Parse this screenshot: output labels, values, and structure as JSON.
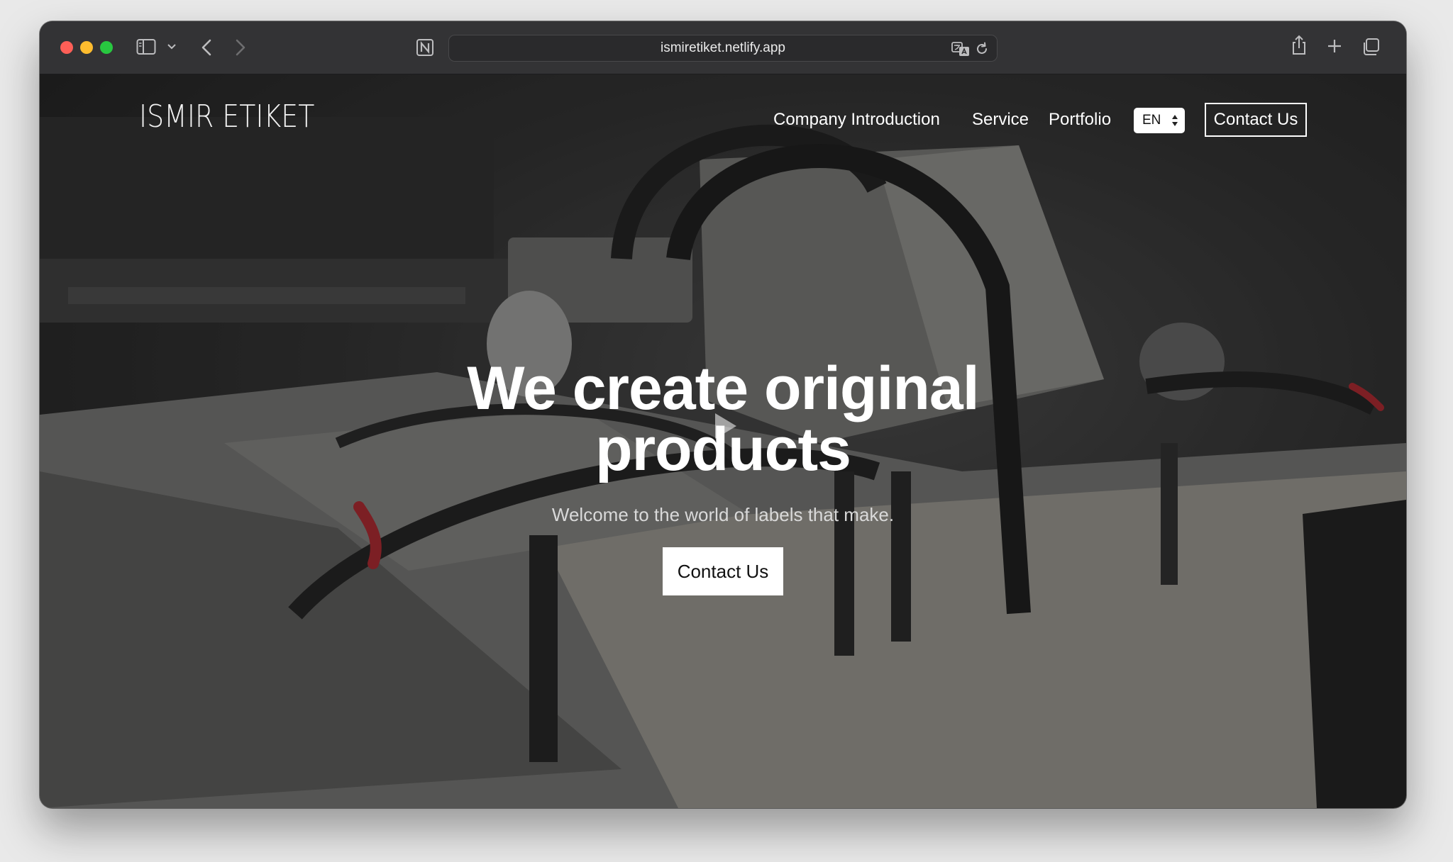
{
  "browser": {
    "url": "ismiretiket.netlify.app",
    "icons": [
      "sidebar-toggle-icon",
      "chevron-down-icon",
      "back-arrow-icon",
      "forward-arrow-icon",
      "notion-icon",
      "translate-icon",
      "reload-icon",
      "share-icon",
      "plus-icon",
      "tabs-overview-icon"
    ]
  },
  "site": {
    "logo": "ISMIR ETIKET",
    "nav": {
      "company": "Company Introduction",
      "service": "Service",
      "portfolio": "Portfolio",
      "language": "EN",
      "contact": "Contact Us"
    },
    "hero": {
      "title": "We create original products",
      "subtitle": "Welcome to the world of labels that make.",
      "cta": "Contact Us"
    }
  },
  "colors": {
    "toolbar": "#333335",
    "traffic_red": "#fe5f57",
    "traffic_yellow": "#febc2e",
    "traffic_green": "#28c840",
    "accent_red": "#c8323a"
  }
}
